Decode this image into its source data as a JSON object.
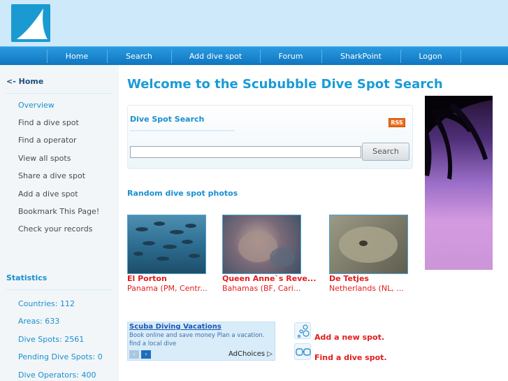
{
  "header": {
    "logo_icon": "shark-fin-icon"
  },
  "nav": {
    "items": [
      {
        "label": "Home"
      },
      {
        "label": "Search"
      },
      {
        "label": "Add dive spot"
      },
      {
        "label": "Forum"
      },
      {
        "label": "SharkPoint"
      },
      {
        "label": "Logon"
      }
    ]
  },
  "sidebar": {
    "home_label": "<- Home",
    "items": [
      {
        "label": "Overview"
      },
      {
        "label": "Find a dive spot"
      },
      {
        "label": "Find a operator"
      },
      {
        "label": "View all spots"
      },
      {
        "label": "Share a dive spot"
      },
      {
        "label": "Add a dive spot"
      },
      {
        "label": "Bookmark This Page!"
      },
      {
        "label": "Check your records"
      }
    ],
    "stats_heading": "Statistics",
    "stats": [
      {
        "label": "Countries: 112"
      },
      {
        "label": "Areas: 633"
      },
      {
        "label": "Dive Spots: 2561"
      },
      {
        "label": "Pending Dive Spots: 0"
      },
      {
        "label": "Dive Operators: 400"
      }
    ]
  },
  "main": {
    "title": "Welcome to the Scububble Dive Spot Search",
    "search": {
      "title": "Dive Spot Search",
      "rss_label": "RSS",
      "input_value": "",
      "button_label": "Search"
    },
    "random_title": "Random dive spot photos",
    "photos": [
      {
        "name": "El Porton",
        "location": "Panama (PM, Centr..."
      },
      {
        "name": "Queen Anne`s Reve...",
        "location": "Bahamas (BF, Cari..."
      },
      {
        "name": "De Tetjes",
        "location": "Netherlands (NL, ..."
      }
    ],
    "ad": {
      "title": "Scuba Diving Vacations",
      "text": "Book online and save money Plan a vacation. find a local dive",
      "prev": "‹",
      "next": "›",
      "adchoices": "AdChoices ▷"
    },
    "actions": [
      {
        "label": "Add a new spot.",
        "icon": "bubbles-diver-icon"
      },
      {
        "label": "Find a dive spot.",
        "icon": "dive-mask-icon"
      }
    ]
  },
  "colors": {
    "nav_blue": "#1a85cf",
    "title_blue": "#1a9bd6",
    "link_red": "#e31b1b",
    "header_bg": "#cde9fa"
  }
}
